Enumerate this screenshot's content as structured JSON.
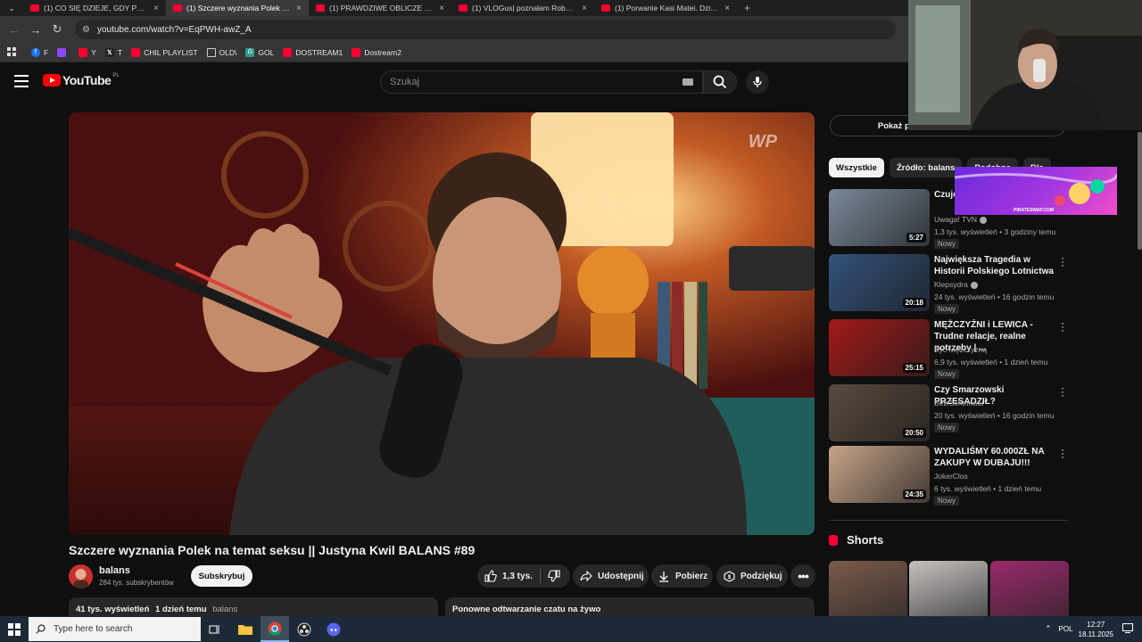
{
  "browser": {
    "tabs": [
      {
        "title": "(1) CO SIĘ DZIEJE, GDY PRZESTA",
        "active": false
      },
      {
        "title": "(1) Szczere wyznania Polek na t",
        "active": true
      },
      {
        "title": "(1) PRAWDZIWE OBLICZE KRYZ",
        "active": false
      },
      {
        "title": "(1) VLOGus| poznałam Roberta",
        "active": false
      },
      {
        "title": "(1) Porwanie Kasi Matei. Dzieck",
        "active": false
      }
    ],
    "new_tab": "+",
    "url": "youtube.com/watch?v=EqPWH-awZ_A",
    "bookmarks": [
      {
        "label": "F",
        "color": "#1877f2"
      },
      {
        "label": "",
        "color": "#9146ff"
      },
      {
        "label": "Y",
        "color": "#ff0033"
      },
      {
        "label": "T",
        "color": "#222222"
      },
      {
        "label": "CHIL PLAYLIST",
        "color": "#ff0033"
      },
      {
        "label": "OLD\\",
        "color": "folder"
      },
      {
        "label": "GOL",
        "color": "#2a9d8f"
      },
      {
        "label": "DOSTREAM1",
        "color": "#ff0033"
      },
      {
        "label": "Dostream2",
        "color": "#ff0033"
      }
    ]
  },
  "youtube": {
    "logo": "YouTube",
    "country": "PL",
    "search_placeholder": "Szukaj"
  },
  "video": {
    "title": "Szczere wyznania Polek na temat seksu || Justyna Kwil BALANS #89",
    "watermark": "WP",
    "channel": "balans",
    "subscribers": "284 tys. subskrybentów",
    "subscribe_label": "Subskrybuj",
    "likes": "1,3 tys.",
    "share_label": "Udostępnij",
    "download_label": "Pobierz",
    "thanks_label": "Podziękuj",
    "views": "41 tys. wyświetleń",
    "age": "1 dzień temu",
    "tag": "balans",
    "chat_replay": "Ponowne odtwarzanie czatu na żywo"
  },
  "sidebar": {
    "show_chat": "Pokaż ponowne odtwarzanie czatu",
    "chips": [
      "Wszystkie",
      "Źródło: balans",
      "Podobne",
      "Dla"
    ],
    "recommendations": [
      {
        "title": "Czujesz się... dnia r...",
        "channel": "Uwaga! TVN",
        "verified": true,
        "meta": "1,3 tys. wyświetleń • 3 godziny temu",
        "badge": "Nowy",
        "duration": "5:27",
        "thumb": "#7a8a9a"
      },
      {
        "title": "Największa Tragedia w Historii Polskiego Lotnictwa",
        "channel": "Klepsydra",
        "verified": true,
        "meta": "24 tys. wyświetleń • 16 godzin temu",
        "badge": "Nowy",
        "duration": "20:18",
        "thumb": "#33527a"
      },
      {
        "title": "MĘŻCZYŹNI i LEWICA - Trudne relacje, realne potrzeby | ...",
        "channel": "Być Mężczyzną",
        "verified": false,
        "meta": "6,9 tys. wyświetleń • 1 dzień temu",
        "badge": "Nowy",
        "duration": "25:15",
        "thumb": "#a21a1a"
      },
      {
        "title": "Czy Smarzowski PRZESADZIŁ?",
        "channel": "Bez/Schematu",
        "verified": false,
        "meta": "20 tys. wyświetleń • 16 godzin temu",
        "badge": "Nowy",
        "duration": "20:50",
        "thumb": "#5a4a3e"
      },
      {
        "title": "WYDALIŚMY 60.000ZŁ NA ZAKUPY W DUBAJU!!!",
        "channel": "JokerClos",
        "verified": false,
        "meta": "6 tys. wyświetleń • 1 dzień temu",
        "badge": "Nowy",
        "duration": "24:35",
        "thumb": "#c9a48a"
      }
    ],
    "shorts_title": "Shorts",
    "shorts_thumbs": [
      "#7a5a4a",
      "#c6c2c0",
      "#9a2a6a"
    ]
  },
  "overlay": {
    "ad_text": "PIRATESWAP.COM"
  },
  "taskbar": {
    "search_placeholder": "Type here to search",
    "lang": "POL",
    "time": "12:27",
    "date": "18.11.2025"
  }
}
